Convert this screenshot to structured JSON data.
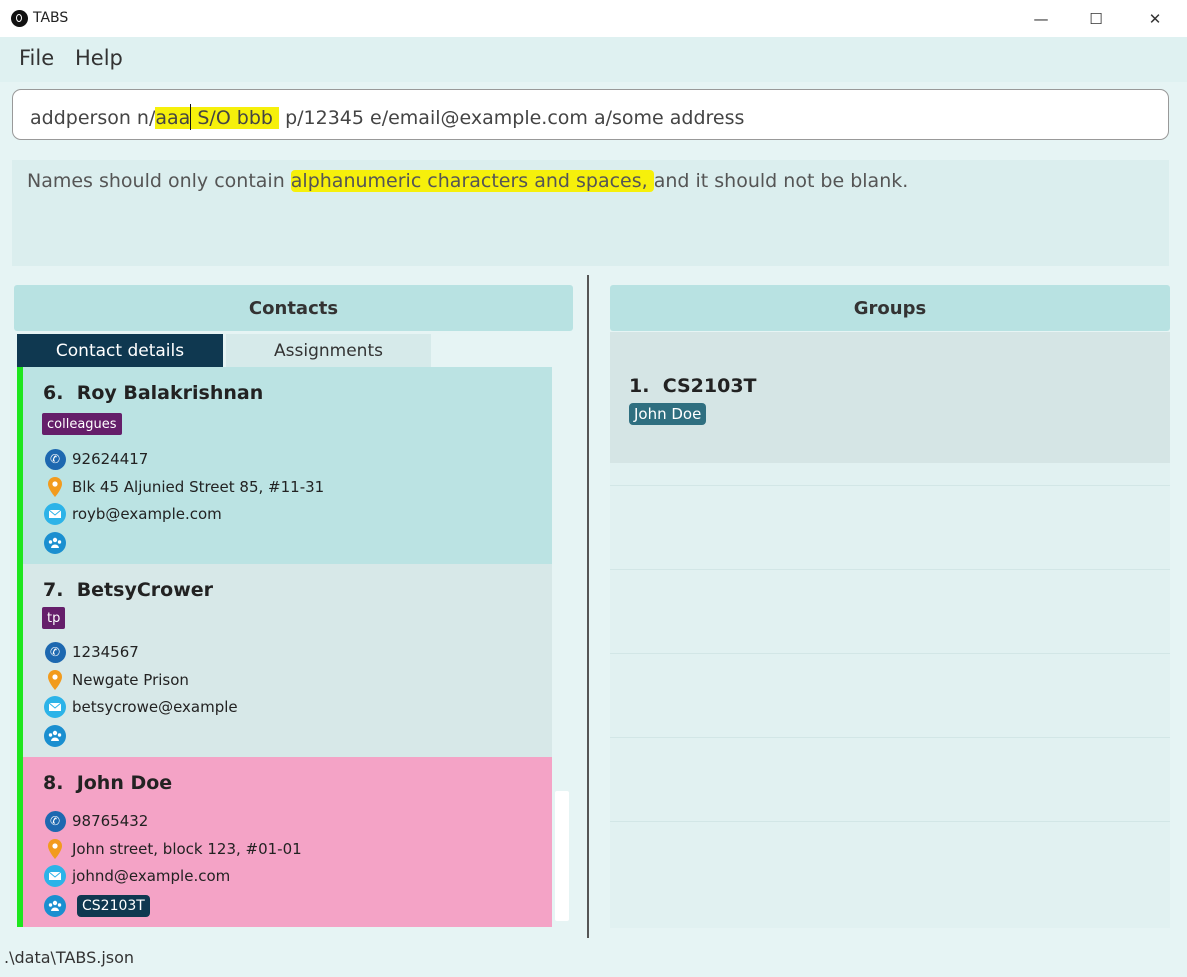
{
  "window": {
    "title": "TABS",
    "minimize": "—",
    "maximize": "☐",
    "close": "✕"
  },
  "menu": {
    "file": "File",
    "help": "Help"
  },
  "command": {
    "before": "addperson n/",
    "hl_a": "aaa",
    "hl_b": " S/O bbb ",
    "after": " p/12345 e/email@example.com a/some address"
  },
  "result": {
    "before": "Names should only contain ",
    "highlight": "alphanumeric characters and spaces, ",
    "after": "and it should not be blank."
  },
  "contacts": {
    "header": "Contacts",
    "tabs": {
      "details": "Contact details",
      "assignments": "Assignments"
    },
    "cards": [
      {
        "index": "6.",
        "name": "Roy Balakrishnan",
        "tag": "colleagues",
        "phone": "92624417",
        "address": "Blk 45 Aljunied Street 85, #11-31",
        "email": "royb@example.com",
        "group": ""
      },
      {
        "index": "7.",
        "name": "BetsyCrower",
        "tag": "tp",
        "phone": "1234567",
        "address": "Newgate Prison",
        "email": "betsycrowe@example",
        "group": ""
      },
      {
        "index": "8.",
        "name": "John Doe",
        "tag": "",
        "phone": "98765432",
        "address": "John street, block 123, #01-01",
        "email": "johnd@example.com",
        "group": "CS2103T"
      }
    ]
  },
  "groups": {
    "header": "Groups",
    "items": [
      {
        "index": "1.",
        "name": "CS2103T",
        "members": [
          "John Doe"
        ]
      }
    ]
  },
  "status": {
    "path": ".\\data\\TABS.json"
  },
  "colors": {
    "accent": "#0f3850",
    "selected_card": "#f4a3c6",
    "card_even": "#bbe3e3",
    "card_odd": "#d7e8e8",
    "highlight": "#f6f00b",
    "tag": "#651e6a"
  }
}
